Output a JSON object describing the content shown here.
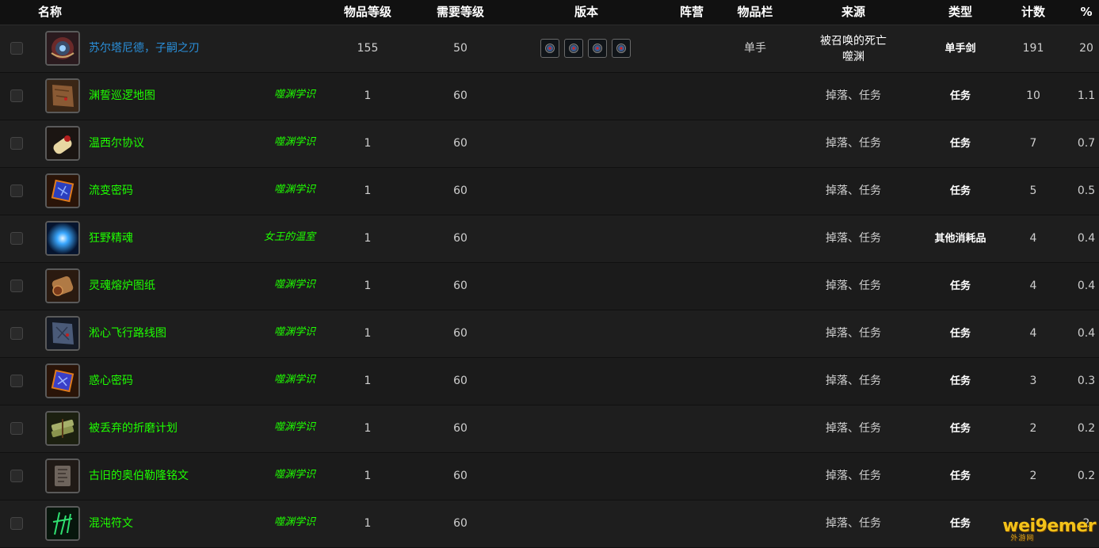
{
  "headers": {
    "name": "名称",
    "item_level": "物品等级",
    "req_level": "需要等级",
    "version": "版本",
    "faction": "阵营",
    "slot": "物品栏",
    "source": "来源",
    "type": "类型",
    "count": "计数",
    "percent": "%"
  },
  "rows": [
    {
      "name": "苏尔塔尼德，子嗣之刃",
      "tag": "",
      "item_level": "155",
      "req_level": "50",
      "slot": "单手",
      "source_line1": "被召唤的死亡",
      "source_line2": "噬渊",
      "source": "",
      "type": "单手剑",
      "count": "191",
      "percent": "20",
      "icon": "sword-icon"
    },
    {
      "name": "渊誓巡逻地图",
      "tag": "噬渊学识",
      "item_level": "1",
      "req_level": "60",
      "slot": "",
      "source": "掉落、任务",
      "type": "任务",
      "count": "10",
      "percent": "1.1",
      "icon": "map-icon"
    },
    {
      "name": "温西尔协议",
      "tag": "噬渊学识",
      "item_level": "1",
      "req_level": "60",
      "slot": "",
      "source": "掉落、任务",
      "type": "任务",
      "count": "7",
      "percent": "0.7",
      "icon": "scroll-icon"
    },
    {
      "name": "流变密码",
      "tag": "噬渊学识",
      "item_level": "1",
      "req_level": "60",
      "slot": "",
      "source": "掉落、任务",
      "type": "任务",
      "count": "5",
      "percent": "0.5",
      "icon": "cipher-cube-icon"
    },
    {
      "name": "狂野精魂",
      "tag": "女王的温室",
      "item_level": "1",
      "req_level": "60",
      "slot": "",
      "source": "掉落、任务",
      "type": "其他消耗品",
      "count": "4",
      "percent": "0.4",
      "icon": "wild-spirit-icon"
    },
    {
      "name": "灵魂熔炉图纸",
      "tag": "噬渊学识",
      "item_level": "1",
      "req_level": "60",
      "slot": "",
      "source": "掉落、任务",
      "type": "任务",
      "count": "4",
      "percent": "0.4",
      "icon": "blueprint-scroll-icon"
    },
    {
      "name": "淞心飞行路线图",
      "tag": "噬渊学识",
      "item_level": "1",
      "req_level": "60",
      "slot": "",
      "source": "掉落、任务",
      "type": "任务",
      "count": "4",
      "percent": "0.4",
      "icon": "flight-map-icon"
    },
    {
      "name": "惑心密码",
      "tag": "噬渊学识",
      "item_level": "1",
      "req_level": "60",
      "slot": "",
      "source": "掉落、任务",
      "type": "任务",
      "count": "3",
      "percent": "0.3",
      "icon": "cipher-cube-icon"
    },
    {
      "name": "被丢弃的折磨计划",
      "tag": "噬渊学识",
      "item_level": "1",
      "req_level": "60",
      "slot": "",
      "source": "掉落、任务",
      "type": "任务",
      "count": "2",
      "percent": "0.2",
      "icon": "bundle-icon"
    },
    {
      "name": "古旧的奥伯勒隆铭文",
      "tag": "噬渊学识",
      "item_level": "1",
      "req_level": "60",
      "slot": "",
      "source": "掉落、任务",
      "type": "任务",
      "count": "2",
      "percent": "0.2",
      "icon": "inscription-tablet-icon"
    },
    {
      "name": "混沌符文",
      "tag": "噬渊学识",
      "item_level": "1",
      "req_level": "60",
      "slot": "",
      "source": "掉落、任务",
      "type": "任务",
      "count": "",
      "percent": "2",
      "icon": "chaos-rune-icon"
    }
  ],
  "version_icons": [
    "version-icon",
    "version-icon",
    "version-icon",
    "version-icon"
  ],
  "watermark": {
    "logo": "wei9emer",
    "sub": "外游网"
  },
  "colors": {
    "header_bg": "#111111",
    "row_bg": "#1e1e1e",
    "uncommon": "#1eff00",
    "rare": "#2a8fd9",
    "text": "#cfcfcf"
  }
}
